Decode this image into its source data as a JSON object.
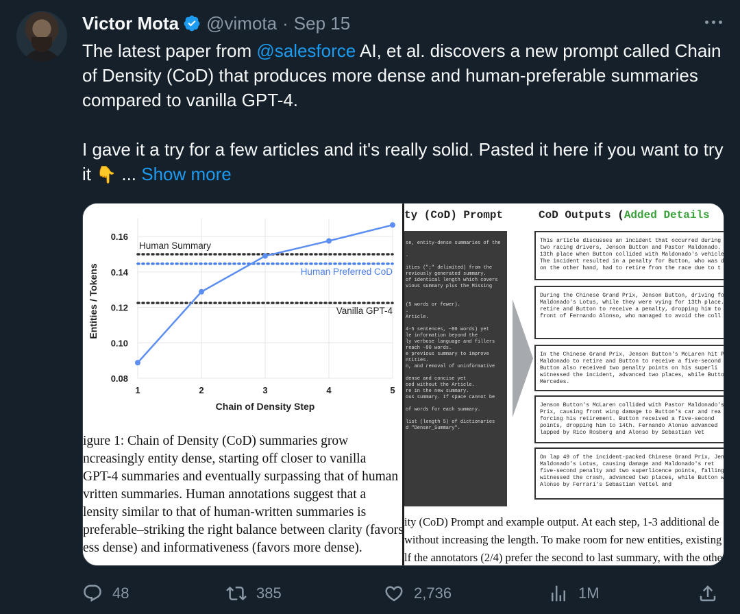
{
  "author": {
    "name": "Victor Mota",
    "handle": "@vimota",
    "separator": "·",
    "date": "Sep 15"
  },
  "tweet": {
    "p1_before": "The latest paper from ",
    "p1_mention": "@salesforce",
    "p1_after": " AI, et al. discovers a new prompt called Chain of Density (CoD) that produces more dense and human-preferable summaries compared to vanilla GPT-4.",
    "p2": "I gave it a try for a few articles and it's really solid. Pasted it here if you want to try it ",
    "emoji": "👇",
    "ellipsis": " ... ",
    "show_more": "Show more"
  },
  "media": {
    "left": {
      "ylabel": "Entities / Tokens",
      "xlabel": "Chain of Density Step",
      "caption": [
        "igure 1:  Chain of Density (CoD) summaries grow",
        "ncreasingly entity dense, starting off closer to vanilla",
        "GPT-4 summaries and eventually surpassing that of human",
        "vritten summaries.  Human annotations suggest that a",
        "lensity similar to that of human-written summaries is",
        "preferable–striking the right balance between clarity (favors",
        "ess dense) and informativeness (favors more dense)."
      ]
    },
    "right": {
      "prompt_title": "ty (CoD) Prompt",
      "outputs_title": "CoD Outputs (",
      "outputs_title_green": "Added Details",
      "prompt_lines": [
        "se, entity-dense summaries of the",
        "",
        ".",
        "",
        "ities (\";\" delimited) from the",
        "reviously generated summary.",
        "of identical length which covers",
        "vious summary plus the Missing",
        "",
        "",
        "(5 words or fewer).",
        ".",
        "Article.",
        "",
        "4-5 sentences, ~80 words) yet",
        "le information beyond the",
        "ly verbose language and fillers",
        "reach ~80 words.",
        "e previous summary to improve",
        "ntities.",
        "n, and removal of uninformative",
        "",
        " dense and concise yet",
        "ood without the Article.",
        "re in the new summary.",
        "ous summary. If space cannot be",
        "",
        "of words for each summary.",
        "",
        " list (length 5) of dictionaries",
        "d \"Denser_Summary\"."
      ],
      "outputs": [
        [
          "This article discusses an incident that occurred during t",
          "  two racing drivers, Jenson Button and Pastor Maldonado.",
          "     13th place when Button collided with Maldonado's vehicle.",
          "The incident resulted in a penalty for Button, who was de",
          "   on the other hand, had to retire from the race due to t"
        ],
        [
          "During the Chinese Grand Prix, Jenson Button, driving for",
          "Maldonado's Lotus, while they were vying for 13th place.",
          "  retire and Button to receive a penalty, dropping him to",
          "    front of Fernando Alonso, who managed to avoid the coll"
        ],
        [
          "In the Chinese Grand Prix, Jenson Button's McLaren hit Pa",
          "Maldonado to retire and Button to receive a five-second",
          "  Button also received two penalty points on his superli",
          "witnessed the incident, advanced two places, while Butto",
          "                  Mercedes."
        ],
        [
          "Jenson Button's McLaren collided with Pastor Maldonado's",
          "  Prix, causing front wing damage to Button's car and rea",
          "  forcing his retirement. Button received a five-second",
          "  points, dropping him to 14th. Fernando Alonso advanced",
          "       lapped by Rico Rosberg and Alonso by Sebastian Vet"
        ],
        [
          "On lap 49 of the incident-packed Chinese Grand Prix, Jens",
          "     Maldonado's Lotus, causing damage and Maldonado's ret",
          "five-second penalty and two superlicence points, falling",
          "  witnessed the crash, advanced two places, while Button w",
          "       Alonso by Ferrari's Sebastian Vettel and"
        ]
      ],
      "caption": [
        "ity (CoD) Prompt and example output.  At each step, 1-3 additional de",
        "without increasing the length.  To make room for new entities, existing c",
        "lf the annotators (2/4) prefer the second to last summary, with the others"
      ]
    }
  },
  "chart_data": {
    "type": "line",
    "xlabel": "Chain of Density Step",
    "ylabel": "Entities / Tokens",
    "x": [
      1,
      2,
      3,
      4,
      5
    ],
    "x_ticks": [
      "1",
      "2",
      "3",
      "4",
      "5"
    ],
    "y_ticks": [
      "0.08",
      "0.10",
      "0.12",
      "0.14",
      "0.16"
    ],
    "ylim": [
      0.08,
      0.167
    ],
    "series": [
      {
        "name": "",
        "values": [
          0.0888,
          0.1288,
          0.149,
          0.1575,
          0.1665
        ],
        "color": "#5b8ef0"
      }
    ],
    "reference_lines": [
      {
        "label": "Human Summary",
        "y": 0.15,
        "color": "#333333",
        "label_pos": "top-left"
      },
      {
        "label": "Human Preferred CoD",
        "y": 0.1446,
        "color": "#4a7fe8",
        "label_pos": "bottom-right"
      },
      {
        "label": "Vanilla GPT-4",
        "y": 0.1225,
        "color": "#333333",
        "label_pos": "bottom-right"
      }
    ],
    "grid": true
  },
  "metrics": {
    "replies": "48",
    "reposts": "385",
    "likes": "2,736",
    "views": "1M"
  },
  "icons": {
    "verified": "verified-badge-icon",
    "more": "more-options-icon",
    "reply": "reply-icon",
    "repost": "repost-icon",
    "like": "heart-icon",
    "views": "views-bar-chart-icon",
    "share": "share-icon"
  },
  "colors": {
    "background": "#15202b",
    "text": "#f7f9f9",
    "secondary": "#8b98a5",
    "accent": "#1d9bf0"
  }
}
